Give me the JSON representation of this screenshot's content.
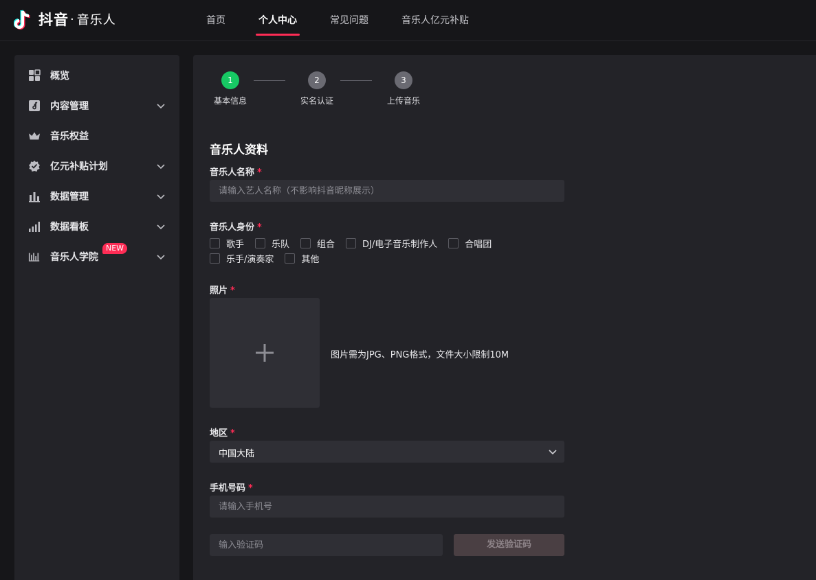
{
  "brand": {
    "name": "抖音",
    "dot": "·",
    "sub": "音乐人",
    "colors": {
      "accent": "#fe2c55",
      "cyan": "#25f4ee",
      "success": "#17c964"
    }
  },
  "nav": {
    "items": [
      {
        "label": "首页"
      },
      {
        "label": "个人中心",
        "active": true
      },
      {
        "label": "常见问题"
      },
      {
        "label": "音乐人亿元补贴"
      }
    ]
  },
  "sidebar": {
    "items": [
      {
        "label": "概览",
        "icon": "grid-icon"
      },
      {
        "label": "内容管理",
        "icon": "music-note-icon",
        "expandable": true
      },
      {
        "label": "音乐权益",
        "icon": "crown-icon"
      },
      {
        "label": "亿元补贴计划",
        "icon": "shield-check-icon",
        "expandable": true
      },
      {
        "label": "数据管理",
        "icon": "bar-chart-icon",
        "expandable": true
      },
      {
        "label": "数据看板",
        "icon": "signal-bars-icon",
        "expandable": true
      },
      {
        "label": "音乐人学院",
        "icon": "academy-icon",
        "expandable": true,
        "badge": "NEW"
      }
    ]
  },
  "steps": [
    {
      "num": "1",
      "label": "基本信息",
      "done": true
    },
    {
      "num": "2",
      "label": "实名认证"
    },
    {
      "num": "3",
      "label": "上传音乐"
    }
  ],
  "form": {
    "section_title": "音乐人资料",
    "required_mark": "*",
    "name": {
      "label": "音乐人名称",
      "placeholder": "请输入艺人名称（不影响抖音昵称展示）"
    },
    "identity": {
      "label": "音乐人身份",
      "options_row1": [
        "歌手",
        "乐队",
        "组合",
        "DJ/电子音乐制作人",
        "合唱团"
      ],
      "options_row2": [
        "乐手/演奏家",
        "其他"
      ]
    },
    "photo": {
      "label": "照片",
      "hint": "图片需为JPG、PNG格式，文件大小限制10M"
    },
    "region": {
      "label": "地区",
      "value": "中国大陆"
    },
    "phone": {
      "label": "手机号码",
      "placeholder": "请输入手机号",
      "code_placeholder": "输入验证码",
      "send_label": "发送验证码"
    }
  }
}
